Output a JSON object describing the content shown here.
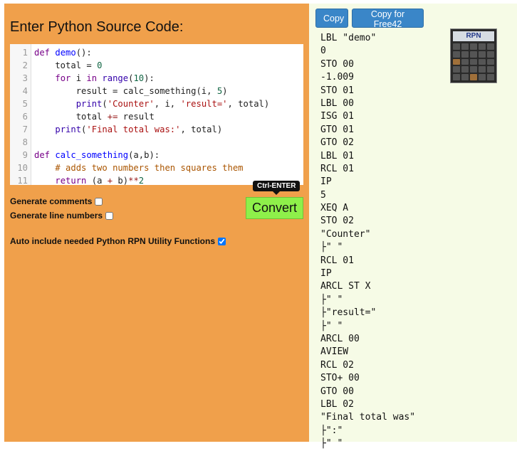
{
  "editor": {
    "title": "Enter Python Source Code:",
    "lines": [
      {
        "n": "1",
        "tokens": [
          {
            "t": "def",
            "c": "kw"
          },
          {
            "t": " "
          },
          {
            "t": "demo",
            "c": "def"
          },
          {
            "t": "():"
          }
        ]
      },
      {
        "n": "2",
        "tokens": [
          {
            "t": "    total = "
          },
          {
            "t": "0",
            "c": "num"
          }
        ]
      },
      {
        "n": "3",
        "tokens": [
          {
            "t": "    "
          },
          {
            "t": "for",
            "c": "kw"
          },
          {
            "t": " i "
          },
          {
            "t": "in",
            "c": "kw"
          },
          {
            "t": " "
          },
          {
            "t": "range",
            "c": "bi"
          },
          {
            "t": "("
          },
          {
            "t": "10",
            "c": "num"
          },
          {
            "t": "):"
          }
        ]
      },
      {
        "n": "4",
        "tokens": [
          {
            "t": "        result = calc_something(i, "
          },
          {
            "t": "5",
            "c": "num"
          },
          {
            "t": ")"
          }
        ]
      },
      {
        "n": "5",
        "tokens": [
          {
            "t": "        "
          },
          {
            "t": "print",
            "c": "bi"
          },
          {
            "t": "("
          },
          {
            "t": "'Counter'",
            "c": "str"
          },
          {
            "t": ", i, "
          },
          {
            "t": "'result='",
            "c": "str"
          },
          {
            "t": ", total)"
          }
        ]
      },
      {
        "n": "6",
        "tokens": [
          {
            "t": "        total "
          },
          {
            "t": "+=",
            "c": "op"
          },
          {
            "t": " result"
          }
        ]
      },
      {
        "n": "7",
        "tokens": [
          {
            "t": "    "
          },
          {
            "t": "print",
            "c": "bi"
          },
          {
            "t": "("
          },
          {
            "t": "'Final total was:'",
            "c": "str"
          },
          {
            "t": ", total)"
          }
        ]
      },
      {
        "n": "8",
        "tokens": []
      },
      {
        "n": "9",
        "tokens": [
          {
            "t": "def",
            "c": "kw"
          },
          {
            "t": " "
          },
          {
            "t": "calc_something",
            "c": "def"
          },
          {
            "t": "(a,b):"
          }
        ]
      },
      {
        "n": "10",
        "tokens": [
          {
            "t": "    "
          },
          {
            "t": "# adds two numbers then squares them",
            "c": "cm"
          }
        ]
      },
      {
        "n": "11",
        "tokens": [
          {
            "t": "    "
          },
          {
            "t": "return",
            "c": "kw"
          },
          {
            "t": " (a "
          },
          {
            "t": "+",
            "c": "op"
          },
          {
            "t": " b)"
          },
          {
            "t": "**",
            "c": "op"
          },
          {
            "t": "2",
            "c": "num"
          }
        ]
      }
    ]
  },
  "options": {
    "generate_comments": {
      "label": "Generate comments",
      "checked": false
    },
    "generate_line_numbers": {
      "label": "Generate line numbers",
      "checked": false
    },
    "auto_include": {
      "label": "Auto include needed Python RPN Utility Functions",
      "checked": true
    }
  },
  "convert": {
    "label": "Convert",
    "tooltip": "Ctrl-ENTER"
  },
  "output_panel": {
    "copy_label": "Copy",
    "copy_free42_label": "Copy for Free42",
    "calculator_logo_text": "RPN",
    "lines": [
      "LBL \"demo\"",
      "0",
      "STO 00",
      "-1.009",
      "STO 01",
      "LBL 00",
      "ISG 01",
      "GTO 01",
      "GTO 02",
      "LBL 01",
      "RCL 01",
      "IP",
      "5",
      "XEQ A",
      "STO 02",
      "\"Counter\"",
      "├\" \"",
      "RCL 01",
      "IP",
      "ARCL ST X",
      "├\" \"",
      "├\"result=\"",
      "├\" \"",
      "ARCL 00",
      "AVIEW",
      "RCL 02",
      "STO+ 00",
      "GTO 00",
      "LBL 02",
      "\"Final total was\"",
      "├\":\"",
      "├\" \""
    ]
  },
  "colors": {
    "left_panel": "#f0a04b",
    "right_panel": "#f6fbe6",
    "convert_button": "#8ef04a",
    "copy_buttons": "#3a86c8"
  }
}
